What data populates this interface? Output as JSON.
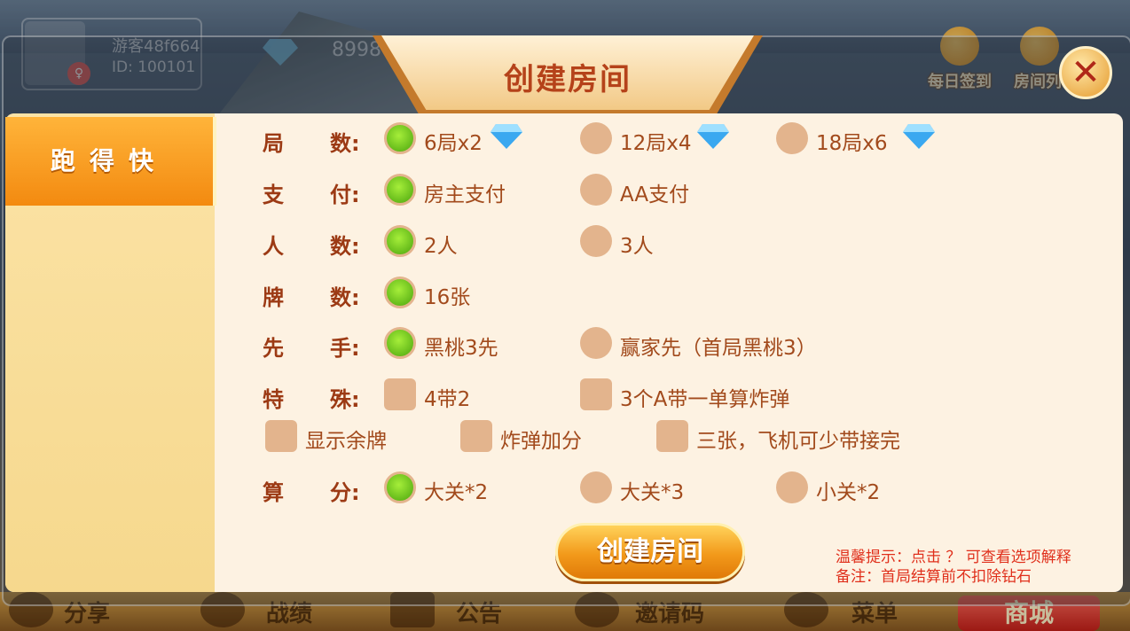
{
  "lobby": {
    "guest_name": "游客48f664",
    "guest_id": "ID: 100101",
    "diamonds": "8998",
    "daily_signin": "每日签到",
    "room_list": "房间列",
    "bottom": {
      "share": "分享",
      "record": "战绩",
      "notice": "公告",
      "invite_code": "邀请码",
      "menu": "菜单",
      "shop": "商城"
    }
  },
  "dialog": {
    "title": "创建房间",
    "sidebar_tab": "跑得快",
    "rows": {
      "rounds": {
        "label_a": "局",
        "label_b": "数:",
        "options": [
          "6局x2",
          "12局x4",
          "18局x6"
        ],
        "selected": 0
      },
      "payment": {
        "label_a": "支",
        "label_b": "付:",
        "options": [
          "房主支付",
          "AA支付"
        ],
        "selected": 0
      },
      "players": {
        "label_a": "人",
        "label_b": "数:",
        "options": [
          "2人",
          "3人"
        ],
        "selected": 0
      },
      "cards": {
        "label_a": "牌",
        "label_b": "数:",
        "options": [
          "16张"
        ],
        "selected": 0
      },
      "first": {
        "label_a": "先",
        "label_b": "手:",
        "options": [
          "黑桃3先",
          "赢家先（首局黑桃3）"
        ],
        "selected": 0
      },
      "special": {
        "label_a": "特",
        "label_b": "殊:",
        "options": [
          "4带2",
          "3个A带一单算炸弹"
        ]
      },
      "extra": {
        "options": [
          "显示余牌",
          "炸弹加分",
          "三张，飞机可少带接完"
        ]
      },
      "scoring": {
        "label_a": "算",
        "label_b": "分:",
        "options": [
          "大关*2",
          "大关*3",
          "小关*2"
        ],
        "selected": 0
      }
    },
    "create_button": "创建房间",
    "hint_line1": "温馨提示：点击 ？ 可查看选项解释",
    "hint_line2": "备注：首局结算前不扣除钻石"
  },
  "colors": {
    "label": "#9c3a14",
    "option_text": "#a24a1c",
    "radio_off": "#e3b48d",
    "radio_on": "#4aa50d",
    "hint": "#e0301c",
    "accent_orange": "#f38a10"
  }
}
